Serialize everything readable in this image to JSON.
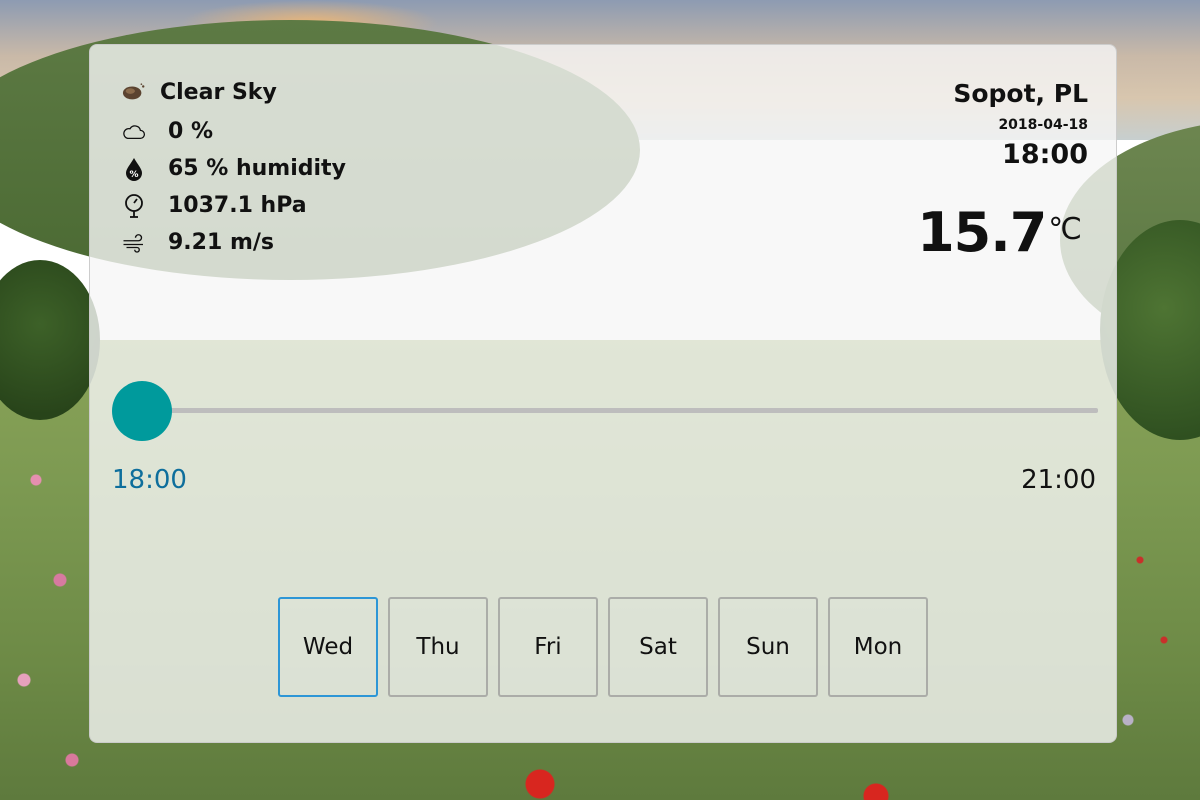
{
  "weather": {
    "condition": "Clear Sky",
    "cloudiness": "0 %",
    "humidity": "65 % humidity",
    "pressure": "1037.1 hPa",
    "wind": "9.21 m/s"
  },
  "location": {
    "city": "Sopot, PL",
    "date": "2018-04-18",
    "time": "18:00",
    "temperature": "15.7",
    "unit": "℃"
  },
  "timeline": {
    "start": "18:00",
    "end": "21:00",
    "position": 0
  },
  "days": [
    "Wed",
    "Thu",
    "Fri",
    "Sat",
    "Sun",
    "Mon"
  ],
  "selected_day": "Wed",
  "colors": {
    "accent": "#009a9c",
    "selected_border": "#2d96d6",
    "time_label": "#0e6e9c"
  },
  "icons": [
    "clear-sky-icon",
    "cloud-icon",
    "humidity-drop-icon",
    "pressure-gauge-icon",
    "wind-icon"
  ]
}
